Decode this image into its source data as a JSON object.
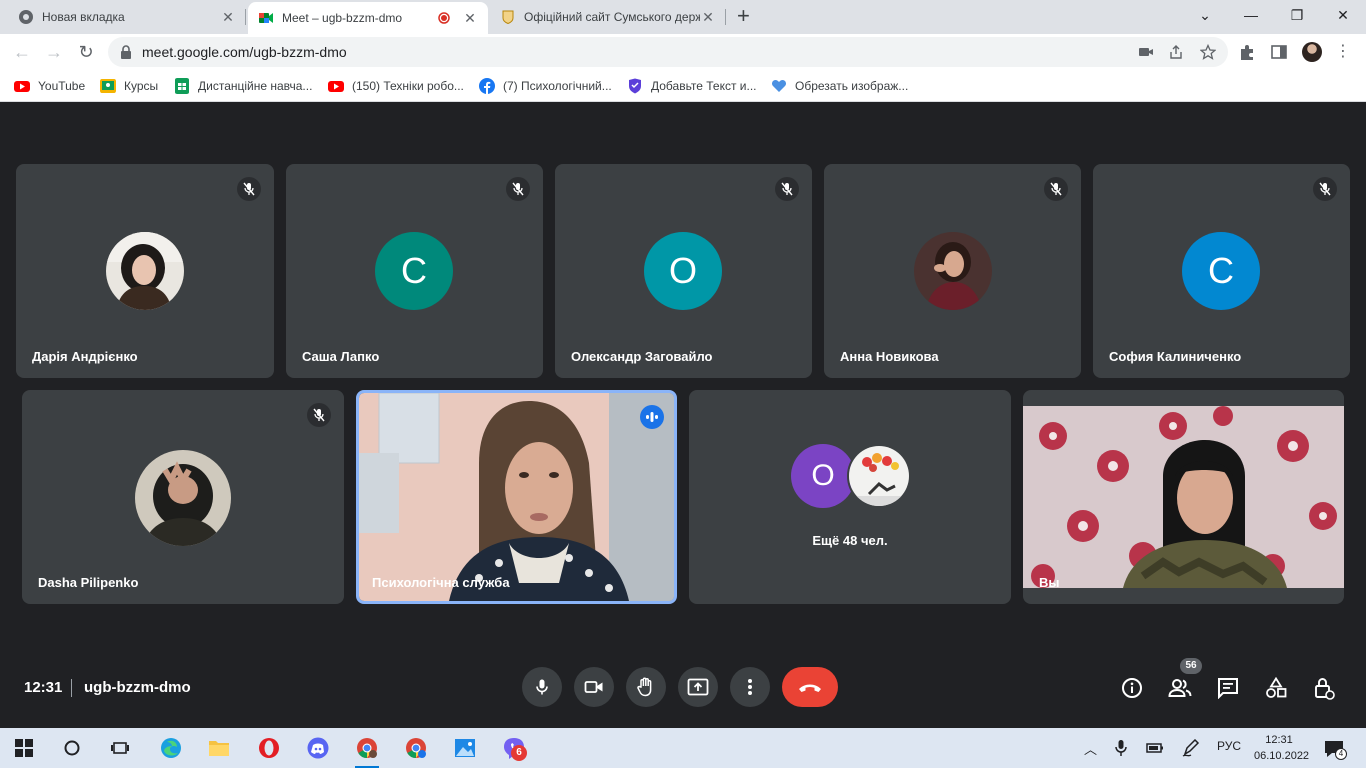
{
  "browser": {
    "tabs": [
      {
        "title": "Новая вкладка",
        "close": "✕"
      },
      {
        "title": "Meet – ugb-bzzm-dmo",
        "close": "✕"
      },
      {
        "title": "Офіційний сайт Сумського держ",
        "close": "✕"
      }
    ],
    "new_tab": "+",
    "window_controls": {
      "dropdown": "⌄",
      "minimize": "—",
      "restore": "❐",
      "close": "✕"
    },
    "url": "meet.google.com/ugb-bzzm-dmo",
    "bookmarks": [
      {
        "label": "YouTube",
        "icon": "youtube-icon",
        "color": "#ff0000"
      },
      {
        "label": "Курсы",
        "icon": "classroom-icon",
        "color": "#f4b400"
      },
      {
        "label": "Дистанційне навча...",
        "icon": "sheets-icon",
        "color": "#0f9d58"
      },
      {
        "label": "(150) Техніки робо...",
        "icon": "youtube-icon",
        "color": "#ff0000"
      },
      {
        "label": "(7) Психологічний...",
        "icon": "facebook-icon",
        "color": "#1877f2"
      },
      {
        "label": "Добавьте Текст и...",
        "icon": "shield-icon",
        "color": "#5b3fd9"
      },
      {
        "label": "Обрезать изображ...",
        "icon": "heart-icon",
        "color": "#4a90e2"
      }
    ]
  },
  "meet": {
    "colors": {
      "bg": "#202124",
      "tile": "#3c4043",
      "active_border": "#8ab4f8",
      "hangup": "#ea4335"
    },
    "participants_row1": [
      {
        "name": "Дарія Андрієнко",
        "avatar_type": "photo",
        "muted": true
      },
      {
        "name": "Саша Лапко",
        "initial": "С",
        "avatar_color": "#00897b",
        "muted": true
      },
      {
        "name": "Олександр Заговайло",
        "initial": "О",
        "avatar_color": "#0097a7",
        "muted": true
      },
      {
        "name": "Анна Новикова",
        "avatar_type": "photo",
        "muted": true
      },
      {
        "name": "София Калиниченко",
        "initial": "С",
        "avatar_color": "#0288d1",
        "muted": true
      }
    ],
    "participants_row2": [
      {
        "name": "Dasha Pilipenko",
        "avatar_type": "photo",
        "muted": true
      },
      {
        "name": "Психологічна служба",
        "video": true,
        "speaking": true
      },
      {
        "more_label": "Ещё 48 чел.",
        "more_initial": "О",
        "more_color": "#7b44c4"
      },
      {
        "name": "Вы",
        "video": true
      }
    ],
    "time": "12:31",
    "meeting_code": "ugb-bzzm-dmo",
    "people_count": "56"
  },
  "taskbar": {
    "language": "РУС",
    "time": "12:31",
    "date": "06.10.2022",
    "notifications": "4",
    "discord_badge": "6"
  }
}
